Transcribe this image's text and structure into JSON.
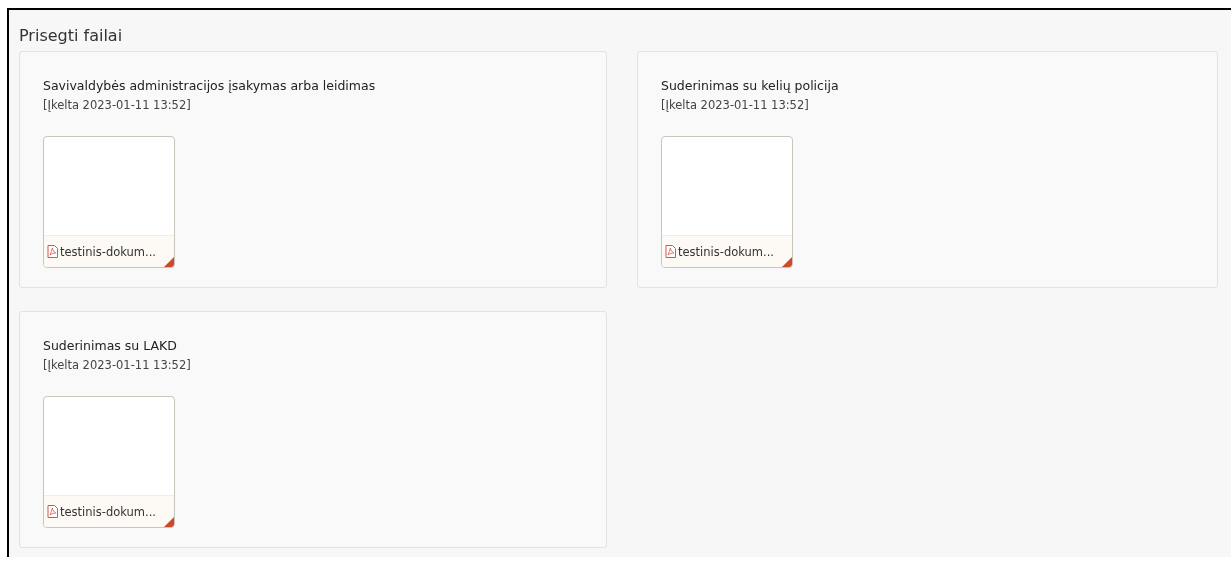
{
  "section": {
    "title": "Prisegti failai"
  },
  "documents": [
    {
      "title": "Savivaldybės administracijos įsakymas arba leidimas",
      "uploaded": "[Įkelta 2023-01-11 13:52]",
      "files": [
        {
          "kind": "pdf",
          "name": "testinis-dokum..."
        }
      ]
    },
    {
      "title": "Suderinimas su kelių policija",
      "uploaded": "[Įkelta 2023-01-11 13:52]",
      "files": [
        {
          "kind": "pdf",
          "name": "testinis-dokum..."
        }
      ]
    },
    {
      "title": "Suderinimas su LAKD",
      "uploaded": "[Įkelta 2023-01-11 13:52]",
      "files": [
        {
          "kind": "pdf",
          "name": "testinis-dokum..."
        }
      ]
    }
  ]
}
